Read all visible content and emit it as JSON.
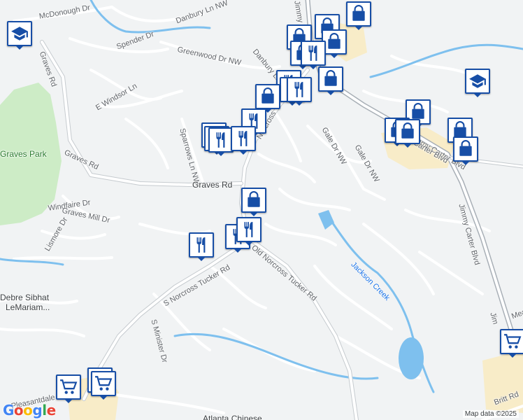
{
  "map": {
    "colors": {
      "background": "#f1f3f4",
      "road": "#ffffff",
      "road_edge": "#d7dadc",
      "major_road": "#a8afb6",
      "park": "#cdecc6",
      "water": "#7ec0ee",
      "commercial": "#f8ecc8",
      "pin_border": "#174ea6",
      "pin_icon": "#174ea6"
    },
    "road_labels": [
      "McDonough Dr",
      "Danbury Ln NW",
      "Spender Dr",
      "Graves Rd",
      "Greenwood Dr NW",
      "Danbury Ln",
      "E Windsor Ln",
      "Jimmy Carter Blvd",
      "Norcross",
      "Gale Dr NW",
      "Gale Dr NW",
      "Jimmy Carter Blvd",
      "Sparrows Ln NW",
      "Graves Rd",
      "Graves Rd",
      "Windfaire Dr",
      "Graves Mill Dr",
      "Lismore Dr",
      "S Norcross Tucker Rd",
      "Old Norcross Tucker Rd",
      "Jimmy Carter Blvd",
      "S Minister Dr",
      "Pleasantdale",
      "Jim",
      "Britt Rd",
      "Mea",
      "Carter Blvd"
    ],
    "park_labels": [
      "Graves Park"
    ],
    "water_labels": [
      "Jackson Creek"
    ],
    "poi_labels": [
      "Debre Sibhat",
      "LeMariam...",
      "Atlanta Chinese"
    ],
    "pins": [
      {
        "icon": "school-icon"
      },
      {
        "icon": "school-icon"
      },
      {
        "icon": "shopping-bag-icon"
      },
      {
        "icon": "shopping-bag-icon"
      },
      {
        "icon": "shopping-bag-icon"
      },
      {
        "icon": "shopping-bag-icon"
      },
      {
        "icon": "shopping-bag-icon"
      },
      {
        "icon": "restaurant-icon"
      },
      {
        "icon": "shopping-bag-icon"
      },
      {
        "icon": "restaurant-icon"
      },
      {
        "icon": "restaurant-icon"
      },
      {
        "icon": "restaurant-icon"
      },
      {
        "icon": "shopping-bag-icon"
      },
      {
        "icon": "shopping-bag-icon"
      },
      {
        "icon": "restaurant-icon"
      },
      {
        "icon": "shopping-bag-icon"
      },
      {
        "icon": "shopping-bag-icon"
      },
      {
        "icon": "shopping-bag-icon"
      },
      {
        "icon": "shopping-bag-icon"
      },
      {
        "icon": "restaurant-icon"
      },
      {
        "icon": "restaurant-icon"
      },
      {
        "icon": "restaurant-icon"
      },
      {
        "icon": "restaurant-icon"
      },
      {
        "icon": "shopping-bag-icon"
      },
      {
        "icon": "restaurant-icon"
      },
      {
        "icon": "restaurant-icon"
      },
      {
        "icon": "restaurant-icon"
      },
      {
        "icon": "shopping-cart-icon"
      },
      {
        "icon": "shopping-cart-icon"
      },
      {
        "icon": "shopping-cart-icon"
      },
      {
        "icon": "shopping-cart-icon"
      }
    ],
    "logo_text": "Google",
    "attribution": "Map data ©2025"
  }
}
